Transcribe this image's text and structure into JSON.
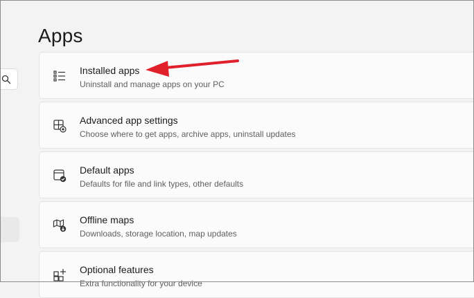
{
  "page": {
    "title": "Apps"
  },
  "cards": [
    {
      "label": "Installed apps",
      "desc": "Uninstall and manage apps on your PC",
      "icon": "list-icon"
    },
    {
      "label": "Advanced app settings",
      "desc": "Choose where to get apps, archive apps, uninstall updates",
      "icon": "app-settings-icon"
    },
    {
      "label": "Default apps",
      "desc": "Defaults for file and link types, other defaults",
      "icon": "default-apps-icon"
    },
    {
      "label": "Offline maps",
      "desc": "Downloads, storage location, map updates",
      "icon": "map-download-icon"
    },
    {
      "label": "Optional features",
      "desc": "Extra functionality for your device",
      "icon": "add-feature-icon"
    }
  ],
  "colors": {
    "annotation_arrow": "#e0202a",
    "background": "#f3f3f3",
    "card": "#fbfbfb"
  }
}
